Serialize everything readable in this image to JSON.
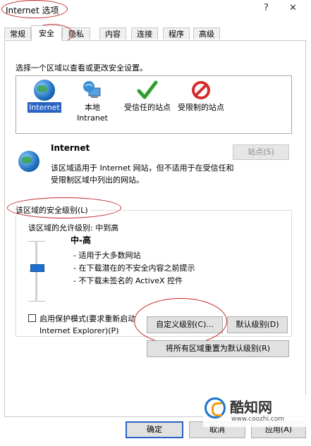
{
  "window": {
    "title": "Internet 选项",
    "help": "?",
    "close": "✕"
  },
  "tabs": [
    {
      "label": "常规"
    },
    {
      "label": "安全"
    },
    {
      "label": "隐私"
    },
    {
      "label": "内容"
    },
    {
      "label": "连接"
    },
    {
      "label": "程序"
    },
    {
      "label": "高级"
    }
  ],
  "security": {
    "zone_prompt": "选择一个区域以查看或更改安全设置。",
    "zones": [
      {
        "label": "Internet",
        "icon": "globe-icon"
      },
      {
        "label": "本地 Intranet",
        "icon": "local-intranet-icon"
      },
      {
        "label": "受信任的站点",
        "icon": "check-icon"
      },
      {
        "label": "受限制的站点",
        "icon": "no-entry-icon"
      }
    ],
    "selected_zone_name": "Internet",
    "selected_zone_desc": "该区域适用于 Internet 网站，但不适用于在受信任和受限制区域中列出的网站。",
    "sites_button": "站点(S)",
    "level_group_label": "该区域的安全级别(L)",
    "allowed_levels": "该区域的允许级别: 中到高",
    "level_name": "中-高",
    "level_points": [
      "- 适用于大多数网站",
      "- 在下载潜在的不安全内容之前提示",
      "- 不下载未签名的 ActiveX 控件"
    ],
    "protected_mode_label": "启用保护模式(要求重新启动 Internet Explorer)(P)",
    "custom_level_button": "自定义级别(C)...",
    "default_level_button": "默认级别(D)",
    "reset_all_button": "将所有区域重置为默认级别(R)"
  },
  "footer": {
    "ok": "确定",
    "cancel": "取消",
    "apply": "应用(A)"
  },
  "watermark": {
    "brand": "酷知网",
    "url": "www.coozhi.com"
  },
  "colors": {
    "selection": "#2a63c5",
    "annotation": "#c62828",
    "slider": "#1e6fd1"
  }
}
